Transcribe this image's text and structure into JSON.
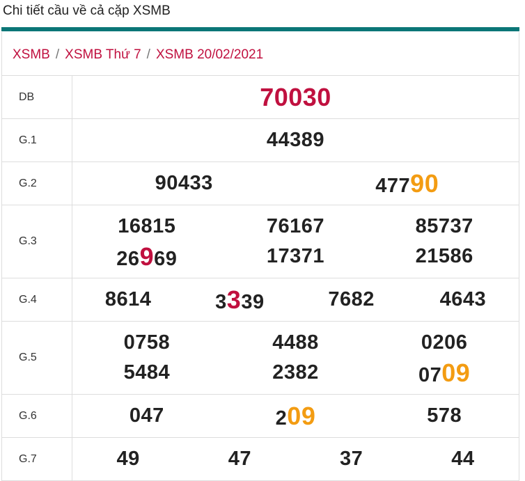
{
  "title": "Chi tiết cầu về cả cặp XSMB",
  "breadcrumb": [
    "XSMB",
    "XSMB Thứ 7",
    "XSMB 20/02/2021"
  ],
  "colors": {
    "teal_bar": "#0b7677",
    "red": "#c0103f",
    "orange": "#f39c12"
  },
  "prizes": [
    {
      "label": "DB",
      "cols": 1,
      "numbers": [
        {
          "text": "70030",
          "special": true
        }
      ]
    },
    {
      "label": "G.1",
      "cols": 1,
      "numbers": [
        {
          "text": "44389"
        }
      ]
    },
    {
      "label": "G.2",
      "cols": 2,
      "numbers": [
        {
          "text": "90433"
        },
        {
          "pre": "477",
          "hl": "90",
          "hl_color": "orange"
        }
      ]
    },
    {
      "label": "G.3",
      "cols": 3,
      "numbers": [
        {
          "text": "16815"
        },
        {
          "text": "76167"
        },
        {
          "text": "85737"
        },
        {
          "pre": "26",
          "hl": "9",
          "post": "69",
          "hl_color": "red"
        },
        {
          "text": "17371"
        },
        {
          "text": "21586"
        }
      ]
    },
    {
      "label": "G.4",
      "cols": 4,
      "numbers": [
        {
          "text": "8614"
        },
        {
          "pre": "3",
          "hl": "3",
          "post": "39",
          "hl_color": "red"
        },
        {
          "text": "7682"
        },
        {
          "text": "4643"
        }
      ]
    },
    {
      "label": "G.5",
      "cols": 3,
      "numbers": [
        {
          "text": "0758"
        },
        {
          "text": "4488"
        },
        {
          "text": "0206"
        },
        {
          "text": "5484"
        },
        {
          "text": "2382"
        },
        {
          "pre": "07",
          "hl": "09",
          "hl_color": "orange"
        }
      ]
    },
    {
      "label": "G.6",
      "cols": 3,
      "numbers": [
        {
          "text": "047"
        },
        {
          "pre": "2",
          "hl": "09",
          "hl_color": "orange"
        },
        {
          "text": "578"
        }
      ]
    },
    {
      "label": "G.7",
      "cols": 4,
      "numbers": [
        {
          "text": "49"
        },
        {
          "text": "47"
        },
        {
          "text": "37"
        },
        {
          "text": "44"
        }
      ]
    }
  ]
}
